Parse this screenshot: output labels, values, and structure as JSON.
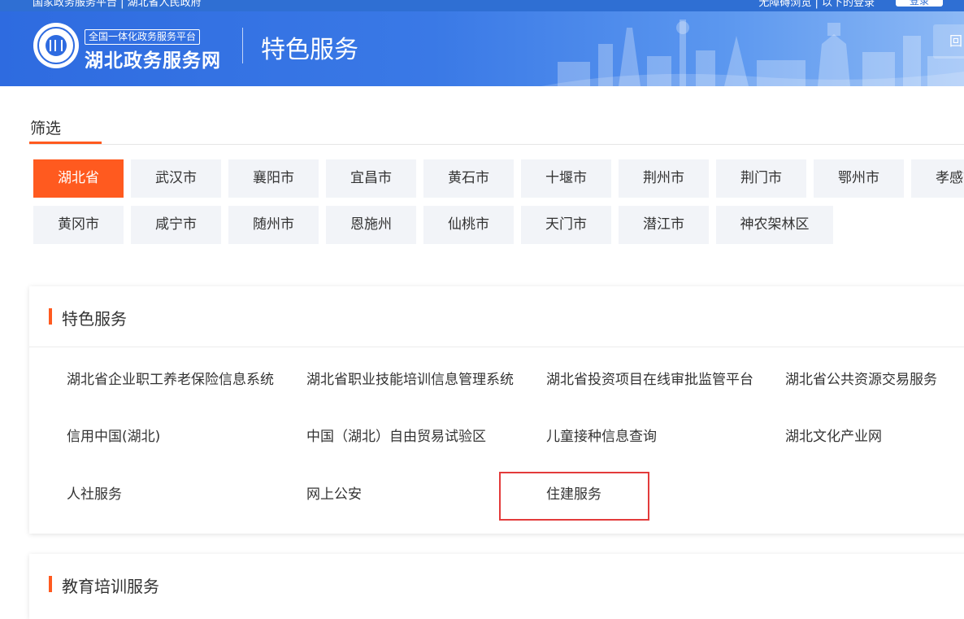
{
  "header": {
    "top_left": "国家政务服务平台 | 湖北省人民政府",
    "top_right": "无障碍浏览 | 以下的登录",
    "login_label": "登录",
    "platform_tag": "全国一体化政务服务平台",
    "site_name": "湖北政务服务网",
    "page_title": "特色服务",
    "back_label": "回"
  },
  "filter": {
    "tab_label": "筛选",
    "regions_row1": [
      "湖北省",
      "武汉市",
      "襄阳市",
      "宜昌市",
      "黄石市",
      "十堰市",
      "荆州市",
      "荆门市",
      "鄂州市",
      "孝感市"
    ],
    "regions_row2": [
      "黄冈市",
      "咸宁市",
      "随州市",
      "恩施州",
      "仙桃市",
      "天门市",
      "潜江市",
      "神农架林区"
    ],
    "active_region": "湖北省"
  },
  "featured": {
    "title": "特色服务",
    "services": [
      "湖北省企业职工养老保险信息系统",
      "湖北省职业技能培训信息管理系统",
      "湖北省投资项目在线审批监管平台",
      "湖北省公共资源交易服务",
      "信用中国(湖北)",
      "中国（湖北）自由贸易试验区",
      "儿童接种信息查询",
      "湖北文化产业网",
      "人社服务",
      "网上公安",
      "住建服务"
    ]
  },
  "education": {
    "title": "教育培训服务"
  },
  "colors": {
    "accent": "#ff5a1f",
    "banner": "#2e6be0",
    "highlight": "#e33b3b"
  }
}
